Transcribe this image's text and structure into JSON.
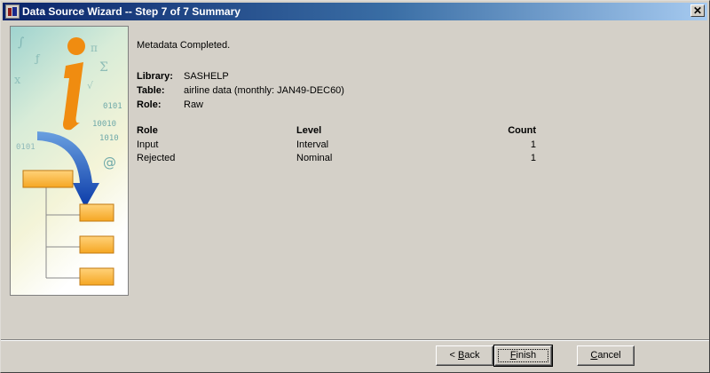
{
  "window": {
    "title": "Data Source Wizard  -- Step 7 of 7  Summary",
    "close_glyph": "✕"
  },
  "graphic": {
    "letter": "i",
    "binary_1": "0101",
    "binary_2": "10010",
    "binary_3": "1010",
    "binary_4": "0101",
    "at_symbol": "@"
  },
  "summary": {
    "status_message": "Metadata Completed.",
    "library_label": "Library:",
    "library_value": "SASHELP",
    "table_label": "Table:",
    "table_value": "airline data (monthly: JAN49-DEC60)",
    "role_label": "Role:",
    "role_value": "Raw"
  },
  "roles_table": {
    "headers": [
      "Role",
      "Level",
      "Count"
    ],
    "rows": [
      [
        "Input",
        "Interval",
        "1"
      ],
      [
        "Rejected",
        "Nominal",
        "1"
      ]
    ]
  },
  "buttons": {
    "back_prefix": "< ",
    "back_mnemonic": "B",
    "back_rest": "ack",
    "finish_mnemonic": "F",
    "finish_rest": "inish",
    "cancel_mnemonic": "C",
    "cancel_rest": "ancel"
  }
}
